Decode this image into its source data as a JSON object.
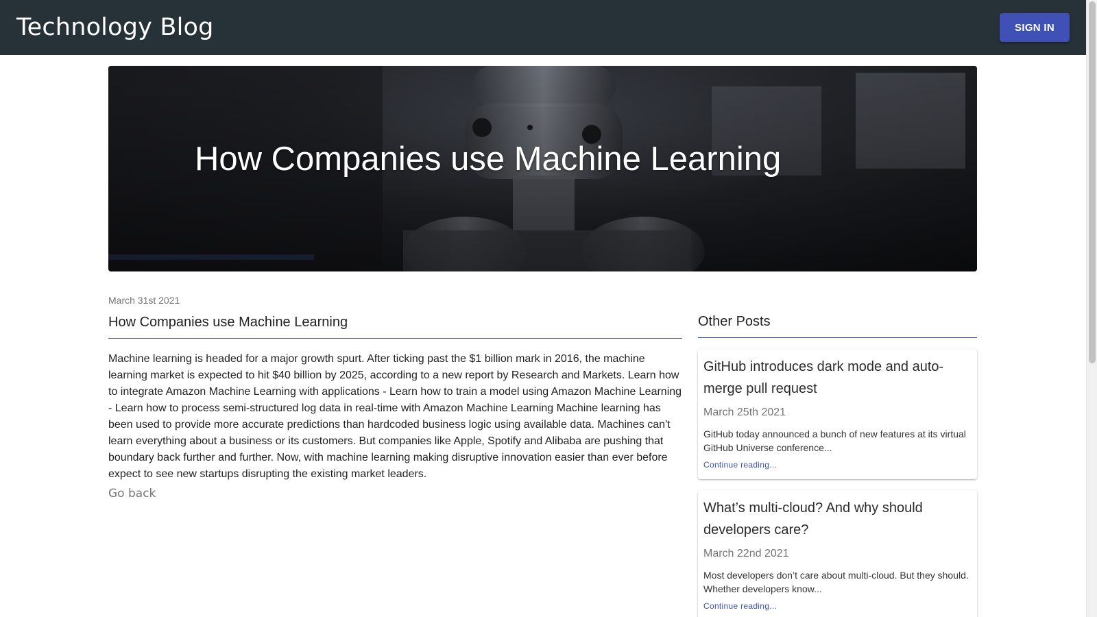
{
  "header": {
    "brand": "Technology Blog",
    "sign_in_label": "SIGN IN"
  },
  "hero": {
    "title": "How Companies use Machine Learning"
  },
  "article": {
    "date": "March 31st 2021",
    "title": "How Companies use Machine Learning",
    "body": "Machine learning is headed for a major growth spurt. After ticking past the $1 billion mark in 2016, the machine learning market is expected to hit $40 billion by 2025, according to a new report by Research and Markets. Learn how to integrate Amazon Machine Learning with applications - Learn how to train a model using Amazon Machine Learning - Learn how to process semi-structured log data in real-time with Amazon Machine Learning Machine learning has been used to provide more accurate predictions than hardcoded business logic using available data. Machines can't learn everything about a business or its customers. But companies like Apple, Spotify and Alibaba are pushing that boundary back further and further. Now, with machine learning making disruptive innovation easier than ever before expect to see new startups disrupting the existing market leaders.",
    "go_back_label": "Go back"
  },
  "sidebar": {
    "heading": "Other Posts",
    "posts": [
      {
        "title": "GitHub introduces dark mode and auto-merge pull request",
        "date": "March 25th 2021",
        "excerpt": "GitHub today announced a bunch of new features at its virtual GitHub Universe conference...",
        "link_label": "Continue reading..."
      },
      {
        "title": "What’s multi-cloud? And why should developers care?",
        "date": "March 22nd 2021",
        "excerpt": "Most developers don’t care about multi-cloud. But they should. Whether developers know...",
        "link_label": "Continue reading..."
      }
    ]
  },
  "colors": {
    "appbar": "#263238",
    "primary": "#3f51b5",
    "muted_text": "#757575"
  }
}
